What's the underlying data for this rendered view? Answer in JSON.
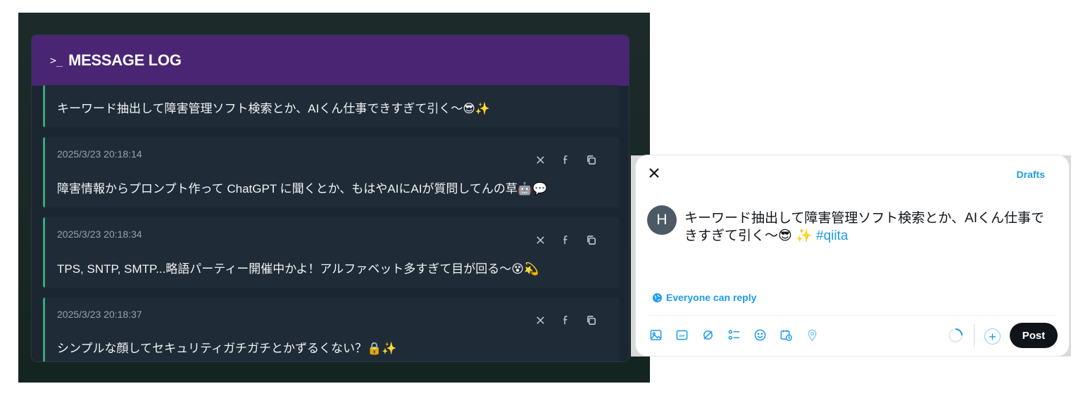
{
  "message_log": {
    "header_icon": "terminal-prompt-icon",
    "title": "MESSAGE LOG",
    "accent_color": "#3aa876",
    "header_color": "#4a2574",
    "messages": [
      {
        "timestamp": "",
        "text": "キーワード抽出して障害管理ソフト検索とか、AIくん仕事できすぎて引く〜😎✨"
      },
      {
        "timestamp": "2025/3/23 20:18:14",
        "text": "障害情報からプロンプト作って ChatGPT に聞くとか、もはやAIにAIが質問してんの草🤖💬"
      },
      {
        "timestamp": "2025/3/23 20:18:34",
        "text": "TPS, SNTP, SMTP...略語パーティー開催中かよ！アルファベット多すぎて目が回る〜😵💫"
      },
      {
        "timestamp": "2025/3/23 20:18:37",
        "text": "シンプルな顔してセキュリティガチガチとかずるくない？🔒✨"
      }
    ],
    "message_actions": [
      "close-icon",
      "facebook-icon",
      "copy-icon"
    ]
  },
  "compose": {
    "drafts_label": "Drafts",
    "avatar_letter": "H",
    "post_text": "キーワード抽出して障害管理ソフト検索とか、AIくん仕事できすぎて引く〜😎 ✨",
    "hashtag": "#qiita",
    "reply_setting": "Everyone can reply",
    "post_button": "Post",
    "add_button": "+",
    "toolbar_icons": [
      "image-icon",
      "gif-icon",
      "grok-icon",
      "poll-icon",
      "emoji-icon",
      "schedule-icon",
      "location-icon"
    ],
    "brand_color": "#1d9bf0"
  }
}
